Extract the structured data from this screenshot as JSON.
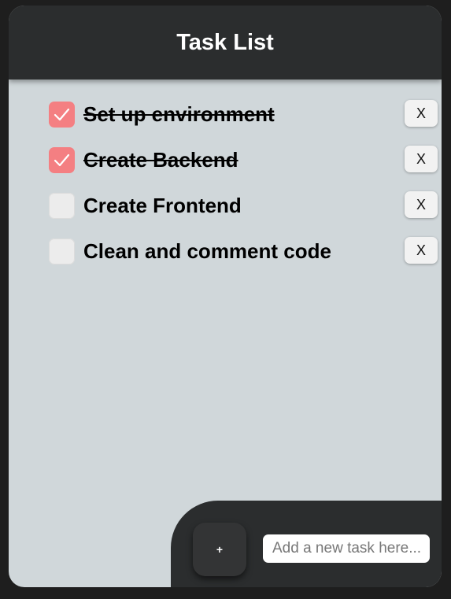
{
  "header": {
    "title": "Task List"
  },
  "tasks": [
    {
      "text": "Set up environment",
      "done": true,
      "delete_label": "X"
    },
    {
      "text": "Create Backend",
      "done": true,
      "delete_label": "X"
    },
    {
      "text": "Create Frontend",
      "done": false,
      "delete_label": "X"
    },
    {
      "text": "Clean and comment code",
      "done": false,
      "delete_label": "X"
    }
  ],
  "footer": {
    "add_label": "+",
    "input_value": "",
    "input_placeholder": "Add a new task here..."
  },
  "colors": {
    "header_bg": "#2b2d2e",
    "body_bg": "#d0d7da",
    "checked": "#f47f82",
    "unchecked": "#ececec"
  },
  "icons": {
    "checkmark": "check-icon"
  }
}
